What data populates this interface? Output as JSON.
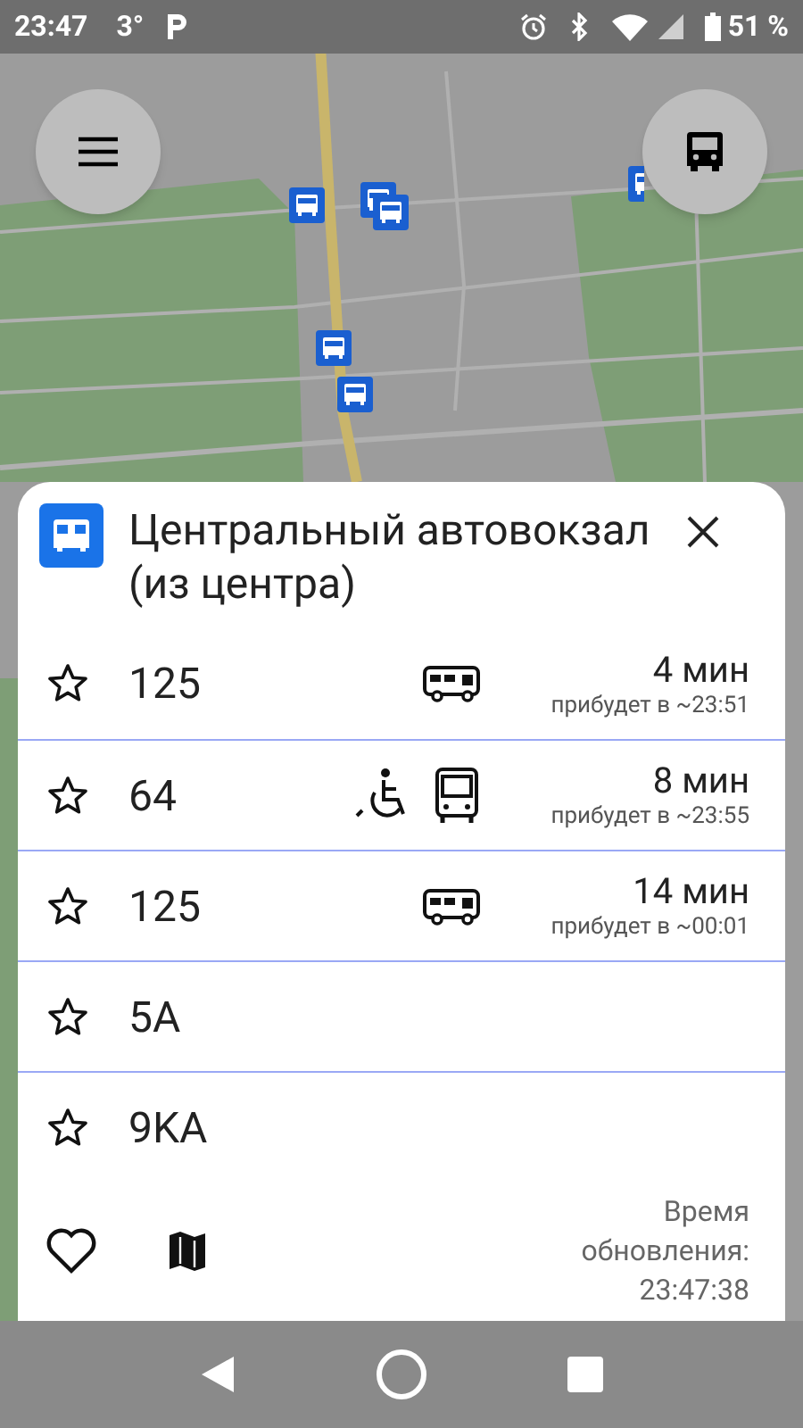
{
  "status_bar": {
    "time": "23:47",
    "temperature": "3°",
    "battery": "51 %"
  },
  "stop": {
    "title": "Центральный автовокзал (из центра)"
  },
  "routes": [
    {
      "kind": "arrival",
      "number": "125",
      "favorite": false,
      "accessible": false,
      "vehicle": {
        "kind": "side"
      },
      "eta": "4 мин",
      "arrives": "прибудет в ~23:51"
    },
    {
      "kind": "arrival",
      "number": "64",
      "favorite": false,
      "accessible": true,
      "vehicle": {
        "kind": "front"
      },
      "eta": "8 мин",
      "arrives": "прибудет в ~23:55"
    },
    {
      "kind": "arrival",
      "number": "125",
      "favorite": false,
      "accessible": false,
      "vehicle": {
        "kind": "side"
      },
      "eta": "14 мин",
      "arrives": "прибудет в ~00:01"
    },
    {
      "kind": "plain",
      "number": "5A",
      "favorite": false
    },
    {
      "kind": "plain",
      "number": "9KA",
      "favorite": false
    }
  ],
  "footer": {
    "updated": "Время обновления: 23:47:38"
  }
}
